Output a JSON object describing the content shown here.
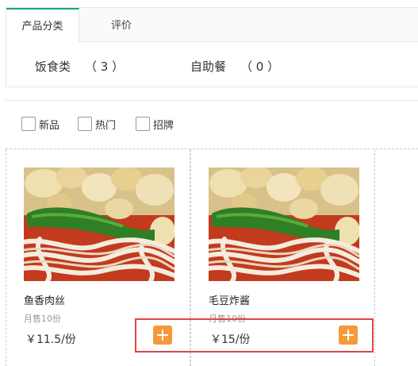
{
  "tabs": [
    {
      "label": "产品分类",
      "active": true
    },
    {
      "label": "评价",
      "active": false
    }
  ],
  "categories": [
    {
      "name": "饭食类",
      "count": "（ 3 ）"
    },
    {
      "name": "自助餐",
      "count": "（ 0 ）"
    }
  ],
  "filters": [
    {
      "label": "新品",
      "checked": false
    },
    {
      "label": "热门",
      "checked": false
    },
    {
      "label": "招牌",
      "checked": false
    }
  ],
  "products": [
    {
      "name": "鱼香肉丝",
      "sales": "月售10份",
      "price": "￥11.5/份",
      "image_icon": "noodle-dish-image"
    },
    {
      "name": "毛豆炸酱",
      "sales": "月售10份",
      "price": "￥15/份",
      "image_icon": "noodle-dish-image"
    }
  ],
  "colors": {
    "accent": "#1aa18a",
    "add_button": "#f49a3a",
    "highlight": "#e04545"
  }
}
